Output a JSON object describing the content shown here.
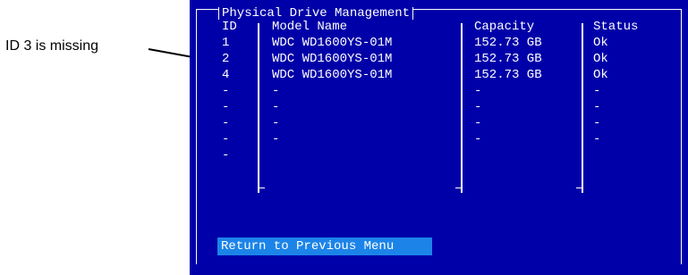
{
  "annotation": {
    "text": "ID 3 is missing"
  },
  "window": {
    "title": "Physical Drive Management"
  },
  "columns": {
    "id": "ID",
    "model": "Model Name",
    "capacity": "Capacity",
    "status": "Status"
  },
  "rows": [
    {
      "id": "1",
      "model": "WDC WD1600YS-01M",
      "capacity": "152.73 GB",
      "status": "Ok"
    },
    {
      "id": "2",
      "model": "WDC WD1600YS-01M",
      "capacity": "152.73 GB",
      "status": "Ok"
    },
    {
      "id": "4",
      "model": "WDC WD1600YS-01M",
      "capacity": "152.73 GB",
      "status": "Ok"
    },
    {
      "id": "-",
      "model": "-",
      "capacity": "-",
      "status": "-"
    },
    {
      "id": "-",
      "model": "-",
      "capacity": "-",
      "status": "-"
    },
    {
      "id": "-",
      "model": "-",
      "capacity": "-",
      "status": "-"
    },
    {
      "id": "-",
      "model": "-",
      "capacity": "-",
      "status": "-"
    },
    {
      "id": "-",
      "model": "",
      "capacity": "",
      "status": ""
    }
  ],
  "menu": {
    "return_label": "Return to Previous Menu"
  },
  "colors": {
    "screen_bg": "#0000a8",
    "highlight": "#1c84e8",
    "text": "#ffffff"
  }
}
